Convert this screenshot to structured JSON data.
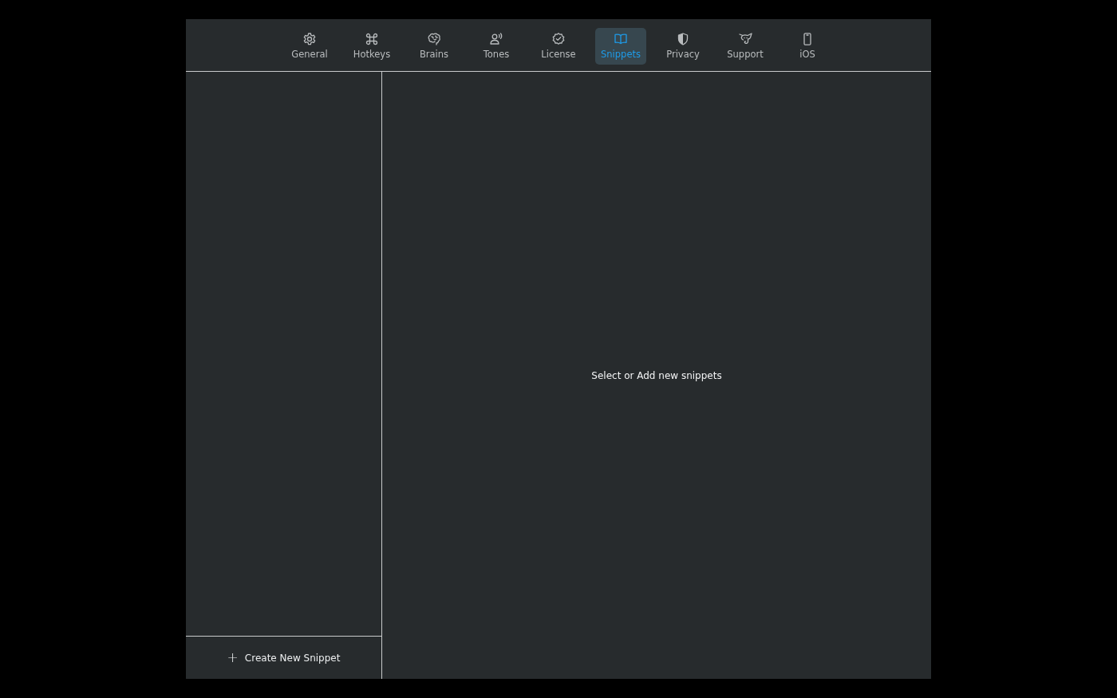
{
  "tabs": [
    {
      "label": "General",
      "kind": "gear",
      "selected": false
    },
    {
      "label": "Hotkeys",
      "kind": "command",
      "selected": false
    },
    {
      "label": "Brains",
      "kind": "brain",
      "selected": false
    },
    {
      "label": "Tones",
      "kind": "voice",
      "selected": false
    },
    {
      "label": "License",
      "kind": "badge",
      "selected": false
    },
    {
      "label": "Snippets",
      "kind": "book",
      "selected": true
    },
    {
      "label": "Privacy",
      "kind": "shield",
      "selected": false
    },
    {
      "label": "Support",
      "kind": "elephant",
      "selected": false
    },
    {
      "label": "iOS",
      "kind": "phone",
      "selected": false
    }
  ],
  "sidebar": {
    "create_button": {
      "icon": "+",
      "label": "Create New Snippet"
    }
  },
  "main": {
    "empty_message": "Select or Add new snippets"
  }
}
